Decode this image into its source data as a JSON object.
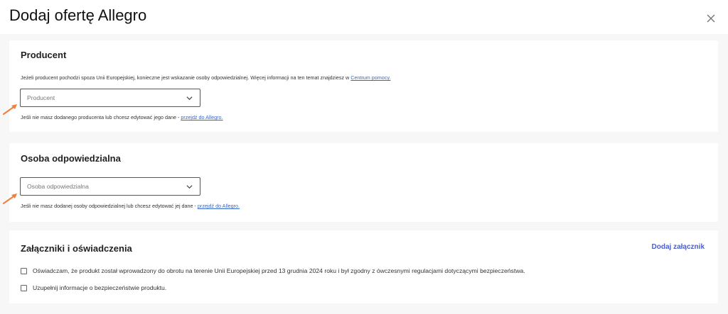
{
  "dialog": {
    "title": "Dodaj ofertę Allegro"
  },
  "producer": {
    "title": "Producent",
    "info_text": "Jeżeli producent pochodzi spoza Unii Europejskiej, konieczne jest wskazanie osoby odpowiedzialnej. Więcej informacji na ten temat znajdziesz w ",
    "info_link": "Centrum pomocy.",
    "select_placeholder": "Producent",
    "hint_text": "Jeśli nie masz dodanego producenta lub chcesz edytować jego dane - ",
    "hint_link": "przejdź do Allegro."
  },
  "responsible": {
    "title": "Osoba odpowiedzialna",
    "select_placeholder": "Osoba odpowiedzialna",
    "hint_text": "Jeśli nie masz dodanej osoby odpowiedzialnej lub chcesz edytować jej dane - ",
    "hint_link": "przejdź do Allegro."
  },
  "attachments": {
    "title": "Załączniki i oświadczenia",
    "add_link": "Dodaj załącznik",
    "checkboxes": [
      {
        "label": "Oświadczam, że produkt został wprowadzony do obrotu na terenie Unii Europejskiej przed 13 grudnia 2024 roku i był zgodny z ówczesnymi regulacjami dotyczącymi bezpieczeństwa.",
        "checked": false
      },
      {
        "label": "Uzupełnij informacje o bezpieczeństwie produktu.",
        "checked": false
      }
    ]
  },
  "colors": {
    "link": "#3b66c9",
    "accent_link": "#4a5fc9",
    "arrow": "#f07f3c"
  },
  "icons": {
    "close": "close-icon",
    "chevron": "chevron-down-icon",
    "annotation_arrow": "arrow-icon"
  }
}
